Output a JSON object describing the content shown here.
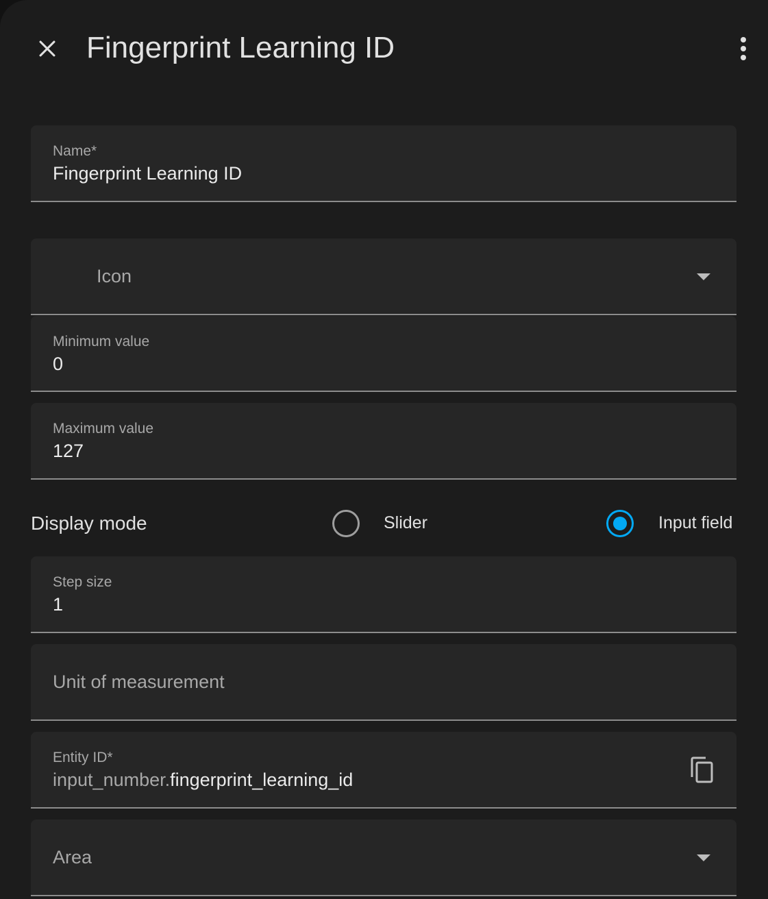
{
  "header": {
    "title": "Fingerprint Learning ID",
    "close_icon": "close-icon",
    "menu_icon": "more-vertical-icon"
  },
  "form": {
    "name": {
      "label": "Name*",
      "value": "Fingerprint Learning ID"
    },
    "icon": {
      "placeholder": "Icon"
    },
    "minimum": {
      "label": "Minimum value",
      "value": "0"
    },
    "maximum": {
      "label": "Maximum value",
      "value": "127"
    },
    "display_mode": {
      "label": "Display mode",
      "options": [
        {
          "label": "Slider",
          "selected": false
        },
        {
          "label": "Input field",
          "selected": true
        }
      ]
    },
    "step": {
      "label": "Step size",
      "value": "1"
    },
    "unit": {
      "placeholder": "Unit of measurement"
    },
    "entity_id": {
      "label": "Entity ID*",
      "prefix": "input_number.",
      "value": "fingerprint_learning_id",
      "copy_icon": "copy-icon"
    },
    "area": {
      "placeholder": "Area"
    }
  },
  "colors": {
    "accent": "#03a9f4",
    "background": "#1c1c1c",
    "field_background": "#262626"
  }
}
